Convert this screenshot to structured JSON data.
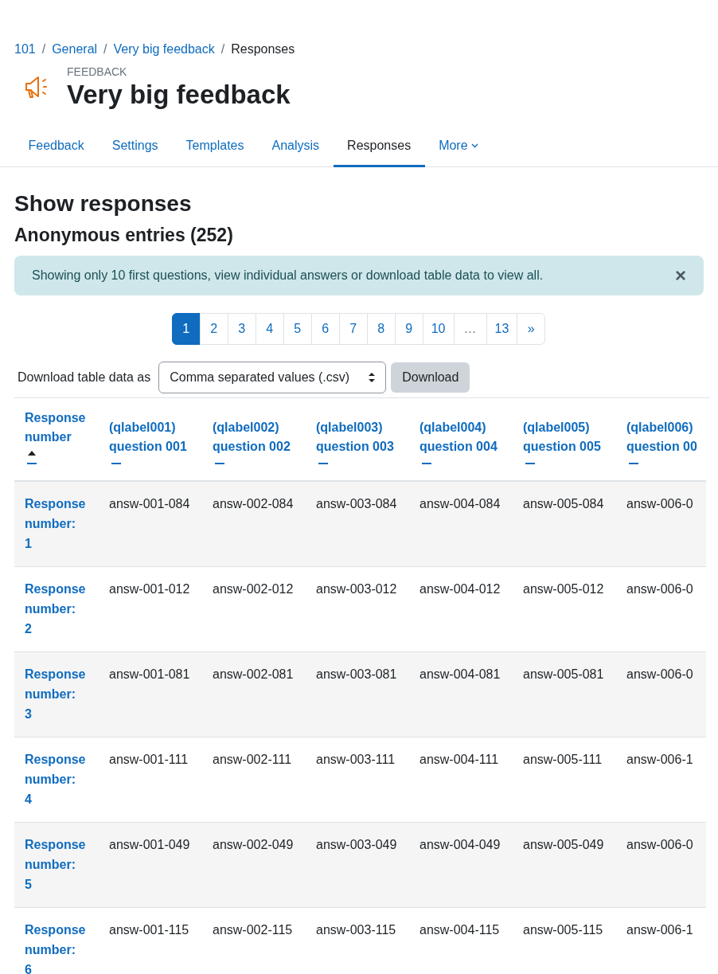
{
  "breadcrumb": {
    "separator": "/",
    "items": [
      {
        "label": "101",
        "kind": "link"
      },
      {
        "label": "General",
        "kind": "link"
      },
      {
        "label": "Very big feedback",
        "kind": "link"
      },
      {
        "label": "Responses",
        "kind": "current"
      }
    ]
  },
  "header": {
    "kicker": "FEEDBACK",
    "title": "Very big feedback"
  },
  "tabs": [
    {
      "label": "Feedback",
      "selected": false
    },
    {
      "label": "Settings",
      "selected": false
    },
    {
      "label": "Templates",
      "selected": false
    },
    {
      "label": "Analysis",
      "selected": false
    },
    {
      "label": "Responses",
      "selected": true
    },
    {
      "label": "More",
      "selected": false,
      "kind": "dropdown"
    }
  ],
  "heading": "Show responses",
  "subheading": "Anonymous entries (252)",
  "alert": {
    "text": "Showing only 10 first questions, view individual answers or download table data to view all.",
    "close": "×"
  },
  "pagination": [
    {
      "label": "1",
      "selected": true
    },
    {
      "label": "2",
      "selected": false
    },
    {
      "label": "3",
      "selected": false
    },
    {
      "label": "4",
      "selected": false
    },
    {
      "label": "5",
      "selected": false
    },
    {
      "label": "6",
      "selected": false
    },
    {
      "label": "7",
      "selected": false
    },
    {
      "label": "8",
      "selected": false
    },
    {
      "label": "9",
      "selected": false
    },
    {
      "label": "10",
      "selected": false
    },
    {
      "label": "…",
      "selected": false,
      "kind": "ellipsis"
    },
    {
      "label": "13",
      "selected": false
    },
    {
      "label": "»",
      "selected": false
    }
  ],
  "download": {
    "label": "Download table data as",
    "format": "Comma separated values (.csv)",
    "button": "Download"
  },
  "table": {
    "columns": [
      {
        "label": "Response number",
        "sorted": true
      },
      {
        "label": "(qlabel001) question 001",
        "sorted": false
      },
      {
        "label": "(qlabel002) question 002",
        "sorted": false
      },
      {
        "label": "(qlabel003) question 003",
        "sorted": false
      },
      {
        "label": "(qlabel004) question 004",
        "sorted": false
      },
      {
        "label": "(qlabel005) question 005",
        "sorted": false
      },
      {
        "label": "(qlabel006) question 00",
        "sorted": false
      }
    ],
    "rows": [
      {
        "cells": [
          "Response number: 1",
          "answ-001-084",
          "answ-002-084",
          "answ-003-084",
          "answ-004-084",
          "answ-005-084",
          "answ-006-0"
        ]
      },
      {
        "cells": [
          "Response number: 2",
          "answ-001-012",
          "answ-002-012",
          "answ-003-012",
          "answ-004-012",
          "answ-005-012",
          "answ-006-0"
        ]
      },
      {
        "cells": [
          "Response number: 3",
          "answ-001-081",
          "answ-002-081",
          "answ-003-081",
          "answ-004-081",
          "answ-005-081",
          "answ-006-0"
        ]
      },
      {
        "cells": [
          "Response number: 4",
          "answ-001-111",
          "answ-002-111",
          "answ-003-111",
          "answ-004-111",
          "answ-005-111",
          "answ-006-1"
        ]
      },
      {
        "cells": [
          "Response number: 5",
          "answ-001-049",
          "answ-002-049",
          "answ-003-049",
          "answ-004-049",
          "answ-005-049",
          "answ-006-0"
        ]
      },
      {
        "cells": [
          "Response number: 6",
          "answ-001-115",
          "answ-002-115",
          "answ-003-115",
          "answ-004-115",
          "answ-005-115",
          "answ-006-1"
        ]
      }
    ]
  }
}
